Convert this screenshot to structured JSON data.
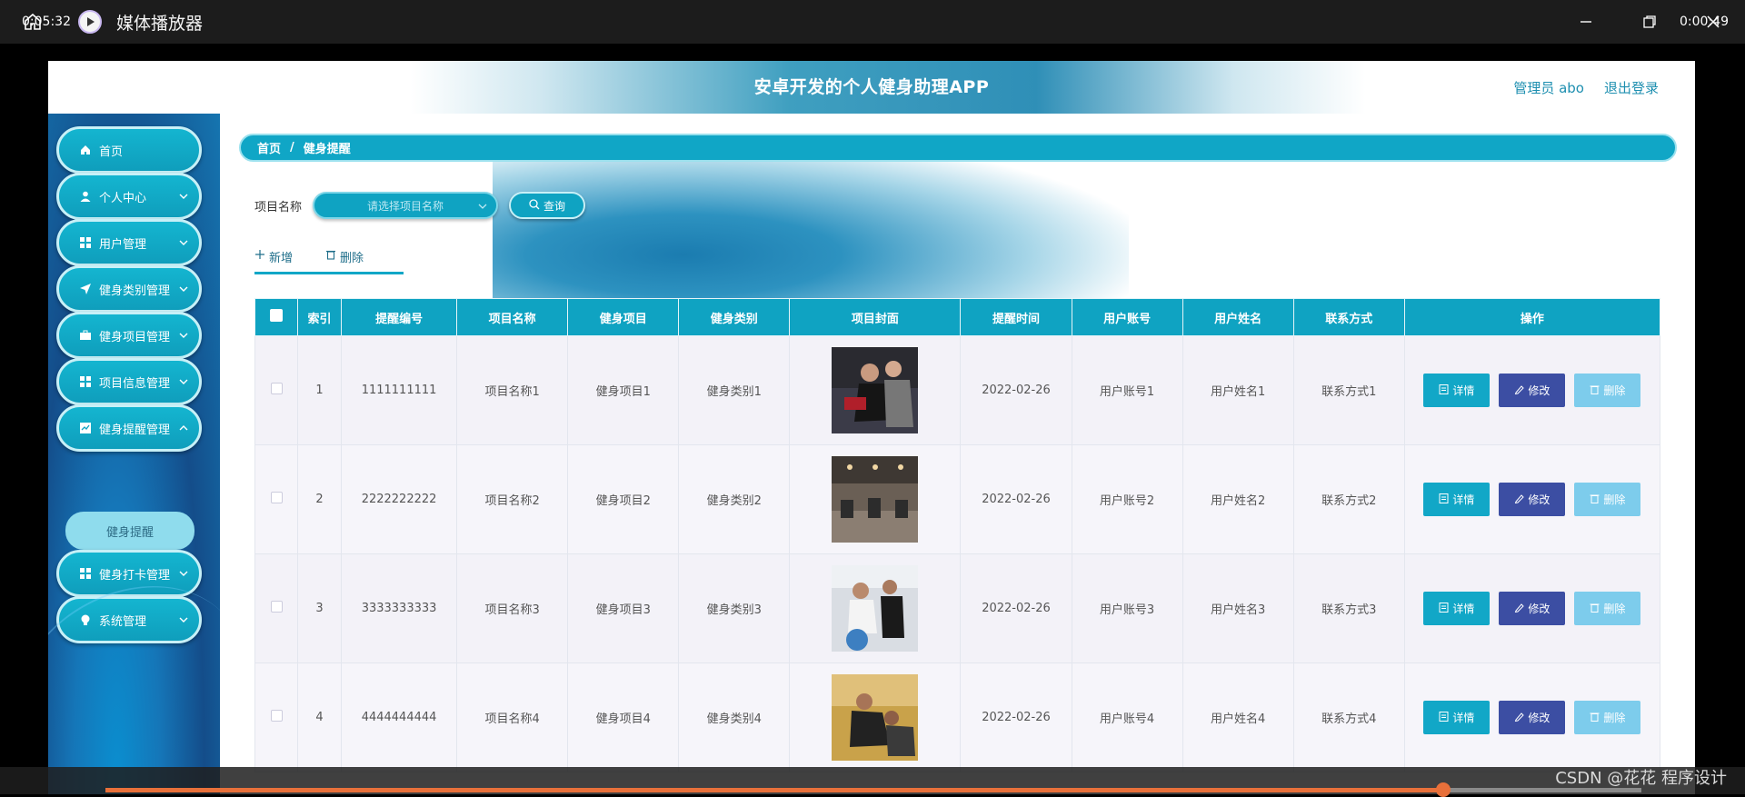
{
  "window": {
    "title": "媒体播放器"
  },
  "app": {
    "title": "安卓开发的个人健身助理APP",
    "user_label": "管理员 abo",
    "logout_label": "退出登录"
  },
  "sidebar": {
    "items": [
      {
        "label": "首页",
        "icon": "home-icon",
        "has_chevron": false
      },
      {
        "label": "个人中心",
        "icon": "user-icon",
        "has_chevron": true
      },
      {
        "label": "用户管理",
        "icon": "grid-icon",
        "has_chevron": true
      },
      {
        "label": "健身类别管理",
        "icon": "send-icon",
        "has_chevron": true
      },
      {
        "label": "健身项目管理",
        "icon": "briefcase-icon",
        "has_chevron": true
      },
      {
        "label": "项目信息管理",
        "icon": "grid-icon",
        "has_chevron": true
      },
      {
        "label": "健身提醒管理",
        "icon": "document-icon",
        "has_chevron": true
      },
      {
        "label": "健身打卡管理",
        "icon": "grid-icon",
        "has_chevron": true
      },
      {
        "label": "系统管理",
        "icon": "bulb-icon",
        "has_chevron": true
      }
    ],
    "submenu_active": "健身提醒"
  },
  "breadcrumb": {
    "home": "首页",
    "separator": "/",
    "current": "健身提醒"
  },
  "search": {
    "label": "项目名称",
    "placeholder": "请选择项目名称",
    "button_label": "查询"
  },
  "actions": {
    "add_label": "新增",
    "delete_label": "删除"
  },
  "table": {
    "headers": [
      "索引",
      "提醒编号",
      "项目名称",
      "健身项目",
      "健身类别",
      "项目封面",
      "提醒时间",
      "用户账号",
      "用户姓名",
      "联系方式",
      "操作"
    ],
    "rows": [
      {
        "index": "1",
        "code": "1111111111",
        "project_name": "项目名称1",
        "fitness_item": "健身项目1",
        "category": "健身类别1",
        "time": "2022-02-26",
        "account": "用户账号1",
        "user_name": "用户姓名1",
        "contact": "联系方式1"
      },
      {
        "index": "2",
        "code": "2222222222",
        "project_name": "项目名称2",
        "fitness_item": "健身项目2",
        "category": "健身类别2",
        "time": "2022-02-26",
        "account": "用户账号2",
        "user_name": "用户姓名2",
        "contact": "联系方式2"
      },
      {
        "index": "3",
        "code": "3333333333",
        "project_name": "项目名称3",
        "fitness_item": "健身项目3",
        "category": "健身类别3",
        "time": "2022-02-26",
        "account": "用户账号3",
        "user_name": "用户姓名3",
        "contact": "联系方式3"
      },
      {
        "index": "4",
        "code": "4444444444",
        "project_name": "项目名称4",
        "fitness_item": "健身项目4",
        "category": "健身类别4",
        "time": "2022-02-26",
        "account": "用户账号4",
        "user_name": "用户姓名4",
        "contact": "联系方式4"
      }
    ],
    "op_labels": {
      "detail": "详情",
      "edit": "修改",
      "delete": "删除"
    }
  },
  "player": {
    "elapsed": "0:05:32",
    "remaining": "0:00:49",
    "progress": 0.871,
    "watermark": "CSDN @花花 程序设计"
  },
  "colors": {
    "accent": "#0fa3c2",
    "edit": "#3c4ea3",
    "delete": "#7dccec",
    "sidebar": "#144d8a",
    "progress": "#e8703a"
  }
}
